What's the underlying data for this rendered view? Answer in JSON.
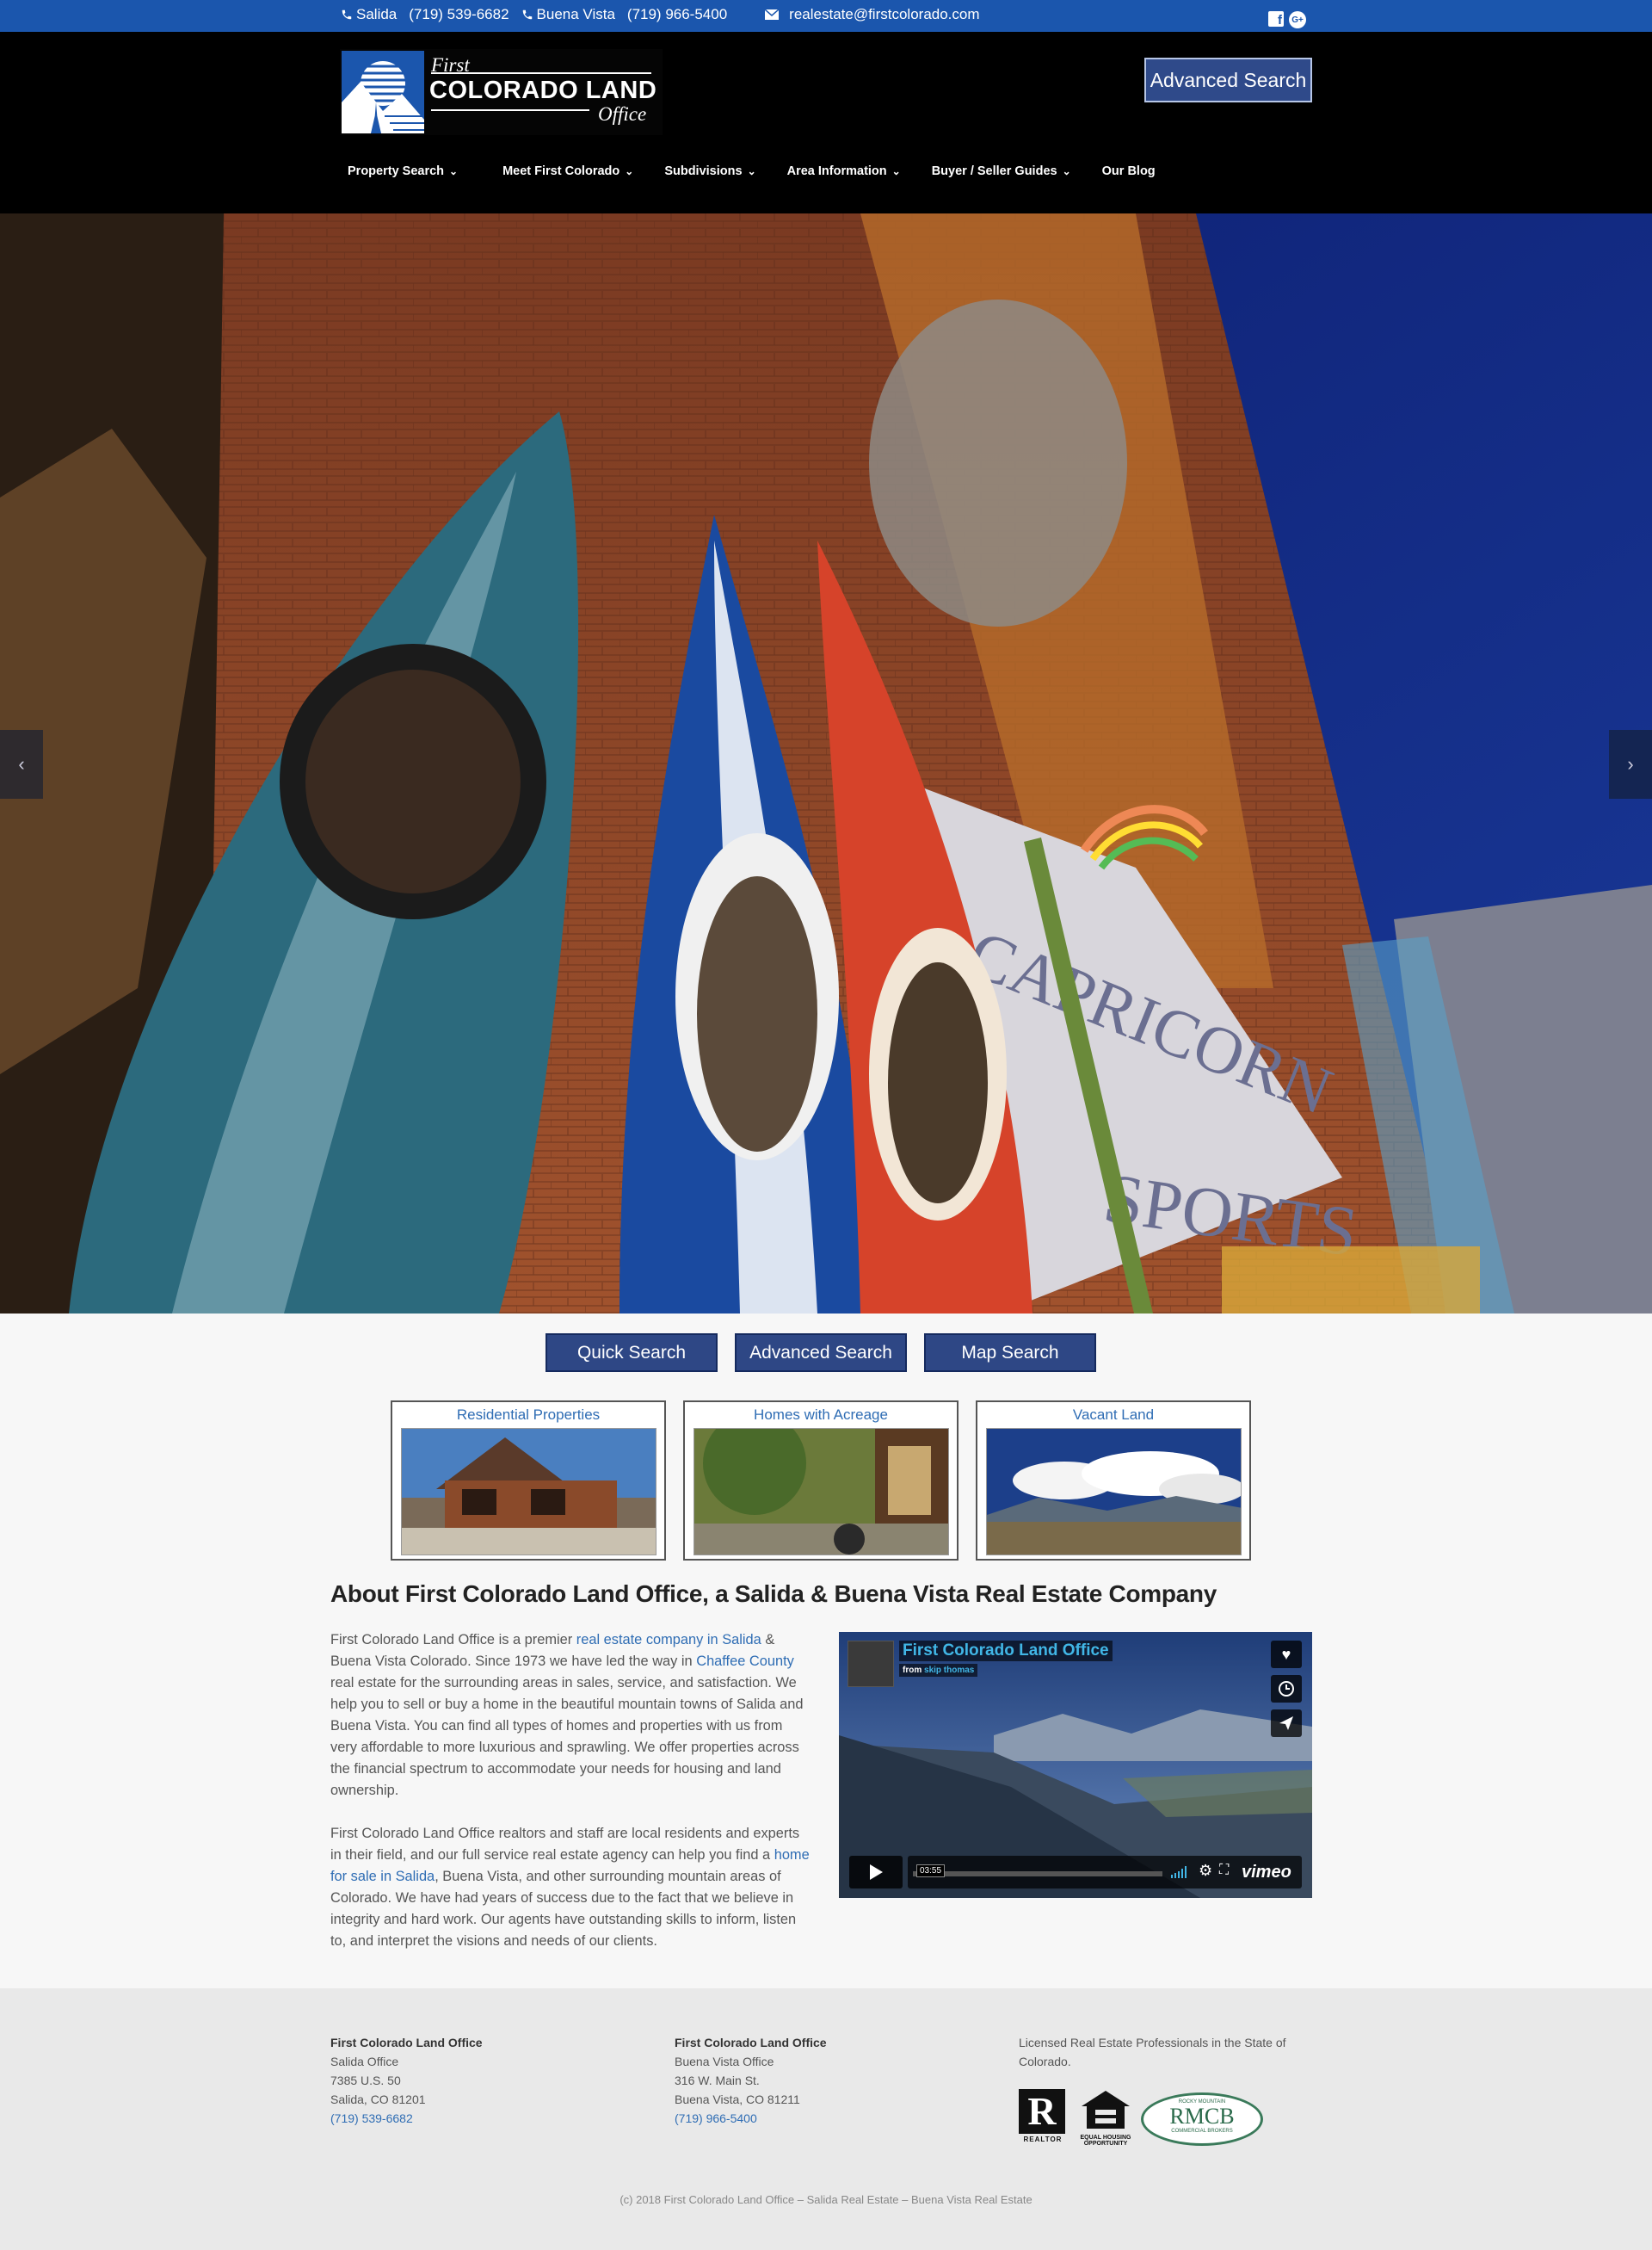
{
  "topbar": {
    "offices": [
      {
        "city": "Salida",
        "phone": "(719) 539-6682"
      },
      {
        "city": "Buena Vista",
        "phone": "(719) 966-5400"
      }
    ],
    "email": "realestate@firstcolorado.com",
    "social": [
      "facebook-icon",
      "google-plus-icon"
    ],
    "google_plus_label": "G+"
  },
  "header": {
    "logo": {
      "first": "First",
      "main": "COLORADO LAND",
      "office": "Office"
    },
    "advanced_search": "Advanced Search",
    "nav": [
      {
        "label": "Property Search",
        "dropdown": true
      },
      {
        "label": "Meet First Colorado",
        "dropdown": true
      },
      {
        "label": "Subdivisions",
        "dropdown": true
      },
      {
        "label": "Area Information",
        "dropdown": true
      },
      {
        "label": "Buyer / Seller Guides",
        "dropdown": true
      },
      {
        "label": "Our Blog",
        "dropdown": false
      }
    ]
  },
  "hero": {
    "prev": "‹",
    "next": "›",
    "mural_lines": [
      "CAPRICORN",
      "SPORTS"
    ]
  },
  "search_buttons": [
    "Quick Search",
    "Advanced Search",
    "Map Search"
  ],
  "categories": [
    "Residential Properties",
    "Homes with Acreage",
    "Vacant Land"
  ],
  "about": {
    "title": "About First Colorado Land Office, a Salida & Buena Vista Real Estate Company",
    "p1": {
      "a": "First Colorado Land Office is a premier ",
      "link1": "real estate company in Salida",
      "b": " & Buena Vista Colorado. Since 1973 we have led the way in ",
      "link2": "Chaffee County",
      "c": " real estate for the surrounding areas in sales, service, and satisfaction. We help you to sell or buy a home in the beautiful mountain towns of Salida and Buena Vista. You can find all types of homes and properties with us from very affordable to more luxurious and sprawling. We offer properties across the financial spectrum to accommodate your needs for housing and land ownership."
    },
    "p2": {
      "a": "First Colorado Land Office realtors and staff are local residents and experts in their field, and our full service real estate agency can help you find a ",
      "link1": "home for sale in Salida",
      "b": ", Buena Vista, and other surrounding mountain areas of Colorado. We have had years of success due to the fact that we believe in integrity and hard work. Our agents have outstanding skills to inform, listen to, and interpret the visions and needs of our clients."
    }
  },
  "video": {
    "title": "First Colorado Land Office",
    "from_label": "from",
    "author": "skip thomas",
    "time": "03:55",
    "brand": "vimeo"
  },
  "footer": {
    "offices": [
      {
        "name": "First Colorado Land Office",
        "office": "Salida Office",
        "street": "7385 U.S. 50",
        "city": "Salida, CO 81201",
        "phone": "(719) 539-6682"
      },
      {
        "name": "First Colorado Land Office",
        "office": "Buena Vista Office",
        "street": "316 W. Main St.",
        "city": "Buena Vista, CO 81211",
        "phone": "(719) 966-5400"
      }
    ],
    "licensed": "Licensed Real Estate Professionals in the State of Colorado.",
    "badges": {
      "realtor": "REALTOR",
      "eho_line1": "EQUAL HOUSING",
      "eho_line2": "OPPORTUNITY",
      "rmcb_top": "ROCKY MOUNTAIN",
      "rmcb": "RMCB",
      "rmcb_bottom": "COMMERCIAL BROKERS"
    },
    "copyright": "(c) 2018 First Colorado Land Office – Salida Real Estate – Buena Vista Real Estate"
  },
  "colors": {
    "topbar": "#1b56ad",
    "header": "#000000",
    "button": "#2e4785",
    "link": "#2f6db4"
  }
}
